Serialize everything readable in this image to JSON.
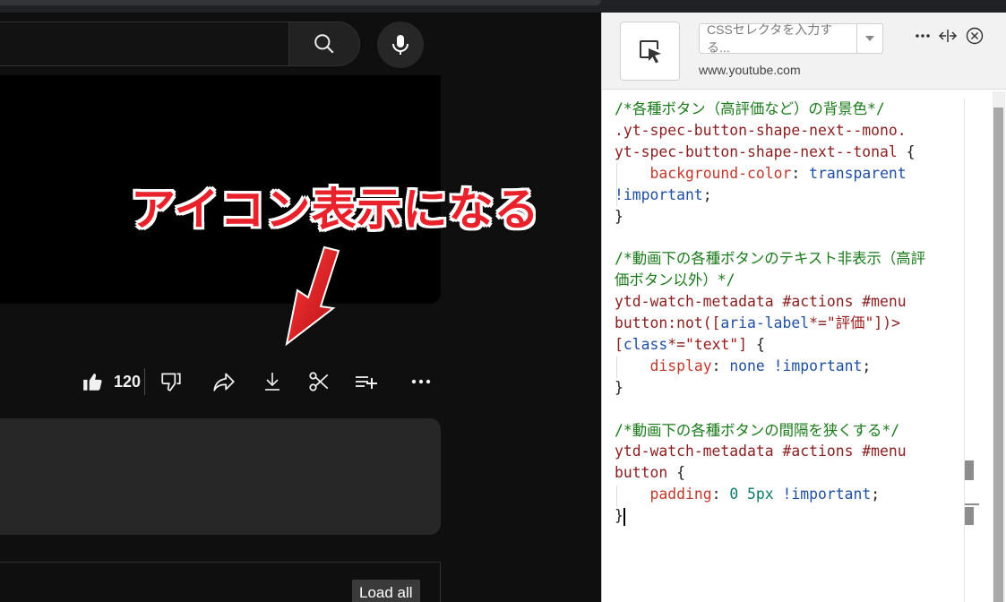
{
  "youtube": {
    "annotation_text": "アイコン表示になる",
    "like_count": "120",
    "load_all_label": "Load all",
    "action_icons": [
      "like-icon",
      "dislike-icon",
      "share-icon",
      "download-icon",
      "clip-icon",
      "save-playlist-icon",
      "more-icon"
    ]
  },
  "extension": {
    "selector_placeholder": "CSSセレクタを入力する...",
    "domain": "www.youtube.com",
    "header_icons": [
      "more-icon",
      "dock-toggle-icon",
      "close-icon"
    ]
  },
  "code": {
    "lines": [
      [
        {
          "t": "/*各種ボタン（高評価など）の背景色*/",
          "c": "c-comment"
        }
      ],
      [
        {
          "t": ".yt-spec-button-shape-next--mono.",
          "c": "c-sel"
        }
      ],
      [
        {
          "t": "yt-spec-button-shape-next--tonal ",
          "c": "c-sel"
        },
        {
          "t": "{",
          "c": "c-punct"
        }
      ],
      [
        {
          "t": "    ",
          "c": "c-punct"
        },
        {
          "t": "background-color",
          "c": "c-prop"
        },
        {
          "t": ": ",
          "c": "c-punct"
        },
        {
          "t": "transparent",
          "c": "c-val"
        }
      ],
      [
        {
          "t": "!important",
          "c": "c-val"
        },
        {
          "t": ";",
          "c": "c-punct"
        }
      ],
      [
        {
          "t": "}",
          "c": "c-punct"
        }
      ],
      [],
      [
        {
          "t": "/*動画下の各種ボタンのテキスト非表示（高評",
          "c": "c-comment"
        }
      ],
      [
        {
          "t": "価ボタン以外）*/",
          "c": "c-comment"
        }
      ],
      [
        {
          "t": "ytd-watch-metadata #actions #menu",
          "c": "c-sel"
        }
      ],
      [
        {
          "t": "button:not([",
          "c": "c-sel"
        },
        {
          "t": "aria-label",
          "c": "c-val"
        },
        {
          "t": "*=",
          "c": "c-sel"
        },
        {
          "t": "\"評価\"",
          "c": "c-str"
        },
        {
          "t": "])>",
          "c": "c-sel"
        }
      ],
      [
        {
          "t": "[",
          "c": "c-sel"
        },
        {
          "t": "class",
          "c": "c-val"
        },
        {
          "t": "*=",
          "c": "c-sel"
        },
        {
          "t": "\"text\"",
          "c": "c-str"
        },
        {
          "t": "] ",
          "c": "c-sel"
        },
        {
          "t": "{",
          "c": "c-punct"
        }
      ],
      [
        {
          "t": "    ",
          "c": "c-punct"
        },
        {
          "t": "display",
          "c": "c-prop"
        },
        {
          "t": ": ",
          "c": "c-punct"
        },
        {
          "t": "none ",
          "c": "c-val"
        },
        {
          "t": "!important",
          "c": "c-val"
        },
        {
          "t": ";",
          "c": "c-punct"
        }
      ],
      [
        {
          "t": "}",
          "c": "c-punct"
        }
      ],
      [],
      [
        {
          "t": "/*動画下の各種ボタンの間隔を狭くする*/",
          "c": "c-comment"
        }
      ],
      [
        {
          "t": "ytd-watch-metadata #actions #menu",
          "c": "c-sel"
        }
      ],
      [
        {
          "t": "button ",
          "c": "c-sel"
        },
        {
          "t": "{",
          "c": "c-punct"
        }
      ],
      [
        {
          "t": "    ",
          "c": "c-punct"
        },
        {
          "t": "padding",
          "c": "c-prop"
        },
        {
          "t": ": ",
          "c": "c-punct"
        },
        {
          "t": "0 5px ",
          "c": "c-num"
        },
        {
          "t": "!important",
          "c": "c-val"
        },
        {
          "t": ";",
          "c": "c-punct"
        }
      ],
      [
        {
          "t": "}",
          "c": "c-punct"
        }
      ]
    ]
  }
}
